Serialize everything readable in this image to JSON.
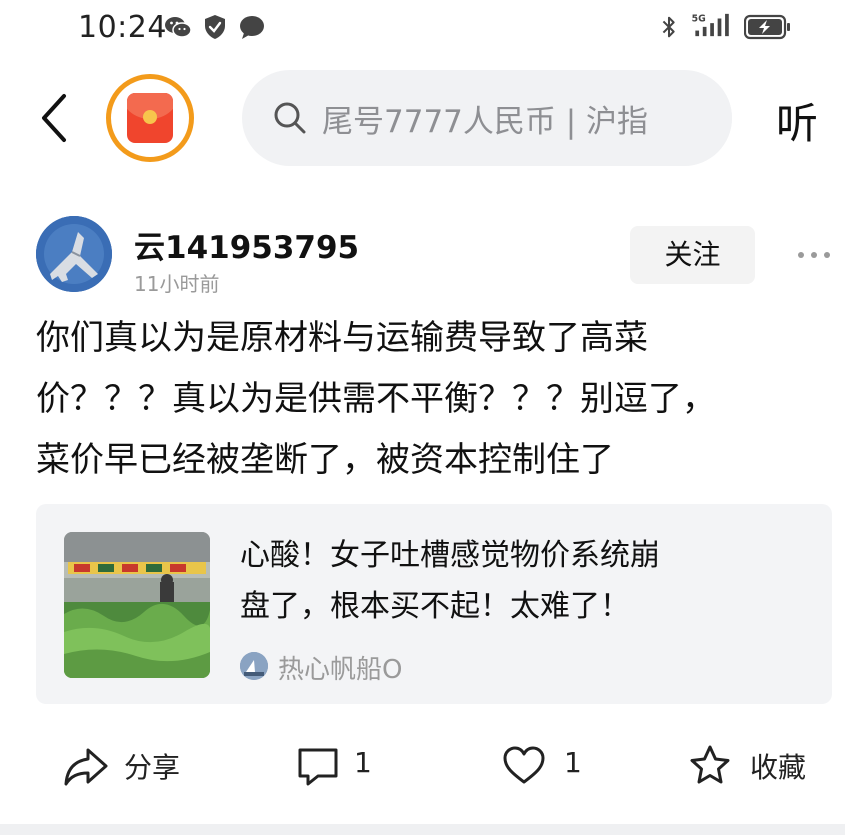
{
  "status_bar": {
    "time": "10:24",
    "left_icons": [
      "wechat-icon",
      "shield-check-icon",
      "chat-bubble-icon"
    ],
    "right_icons": [
      "bluetooth-icon",
      "signal-5g-icon",
      "battery-charging-icon"
    ],
    "network": "5G"
  },
  "top_nav": {
    "search_text": "尾号7777人民币 | 沪指",
    "listen_label": "听"
  },
  "post": {
    "author": "云141953795",
    "time": "11小时前",
    "follow_label": "关注",
    "body_lines": [
      "你们真以为是原材料与运输费导致了高菜",
      "价？？？真以为是供需不平衡？？？别逗了，",
      "菜价早已经被垄断了，被资本控制住了"
    ]
  },
  "shared_article": {
    "title_lines": [
      "心酸！女子吐槽感觉物价系统崩",
      "盘了，根本买不起！太难了！"
    ],
    "source": "热心帆船O"
  },
  "actions": {
    "share_label": "分享",
    "comment_count": "1",
    "like_count": "1",
    "favorite_label": "收藏"
  },
  "colors": {
    "accent_orange": "#f39b1b",
    "redpack_red": "#f0452d",
    "search_bg": "#f1f2f4",
    "card_bg": "#f3f4f6",
    "muted_text": "#9a9a9a"
  }
}
